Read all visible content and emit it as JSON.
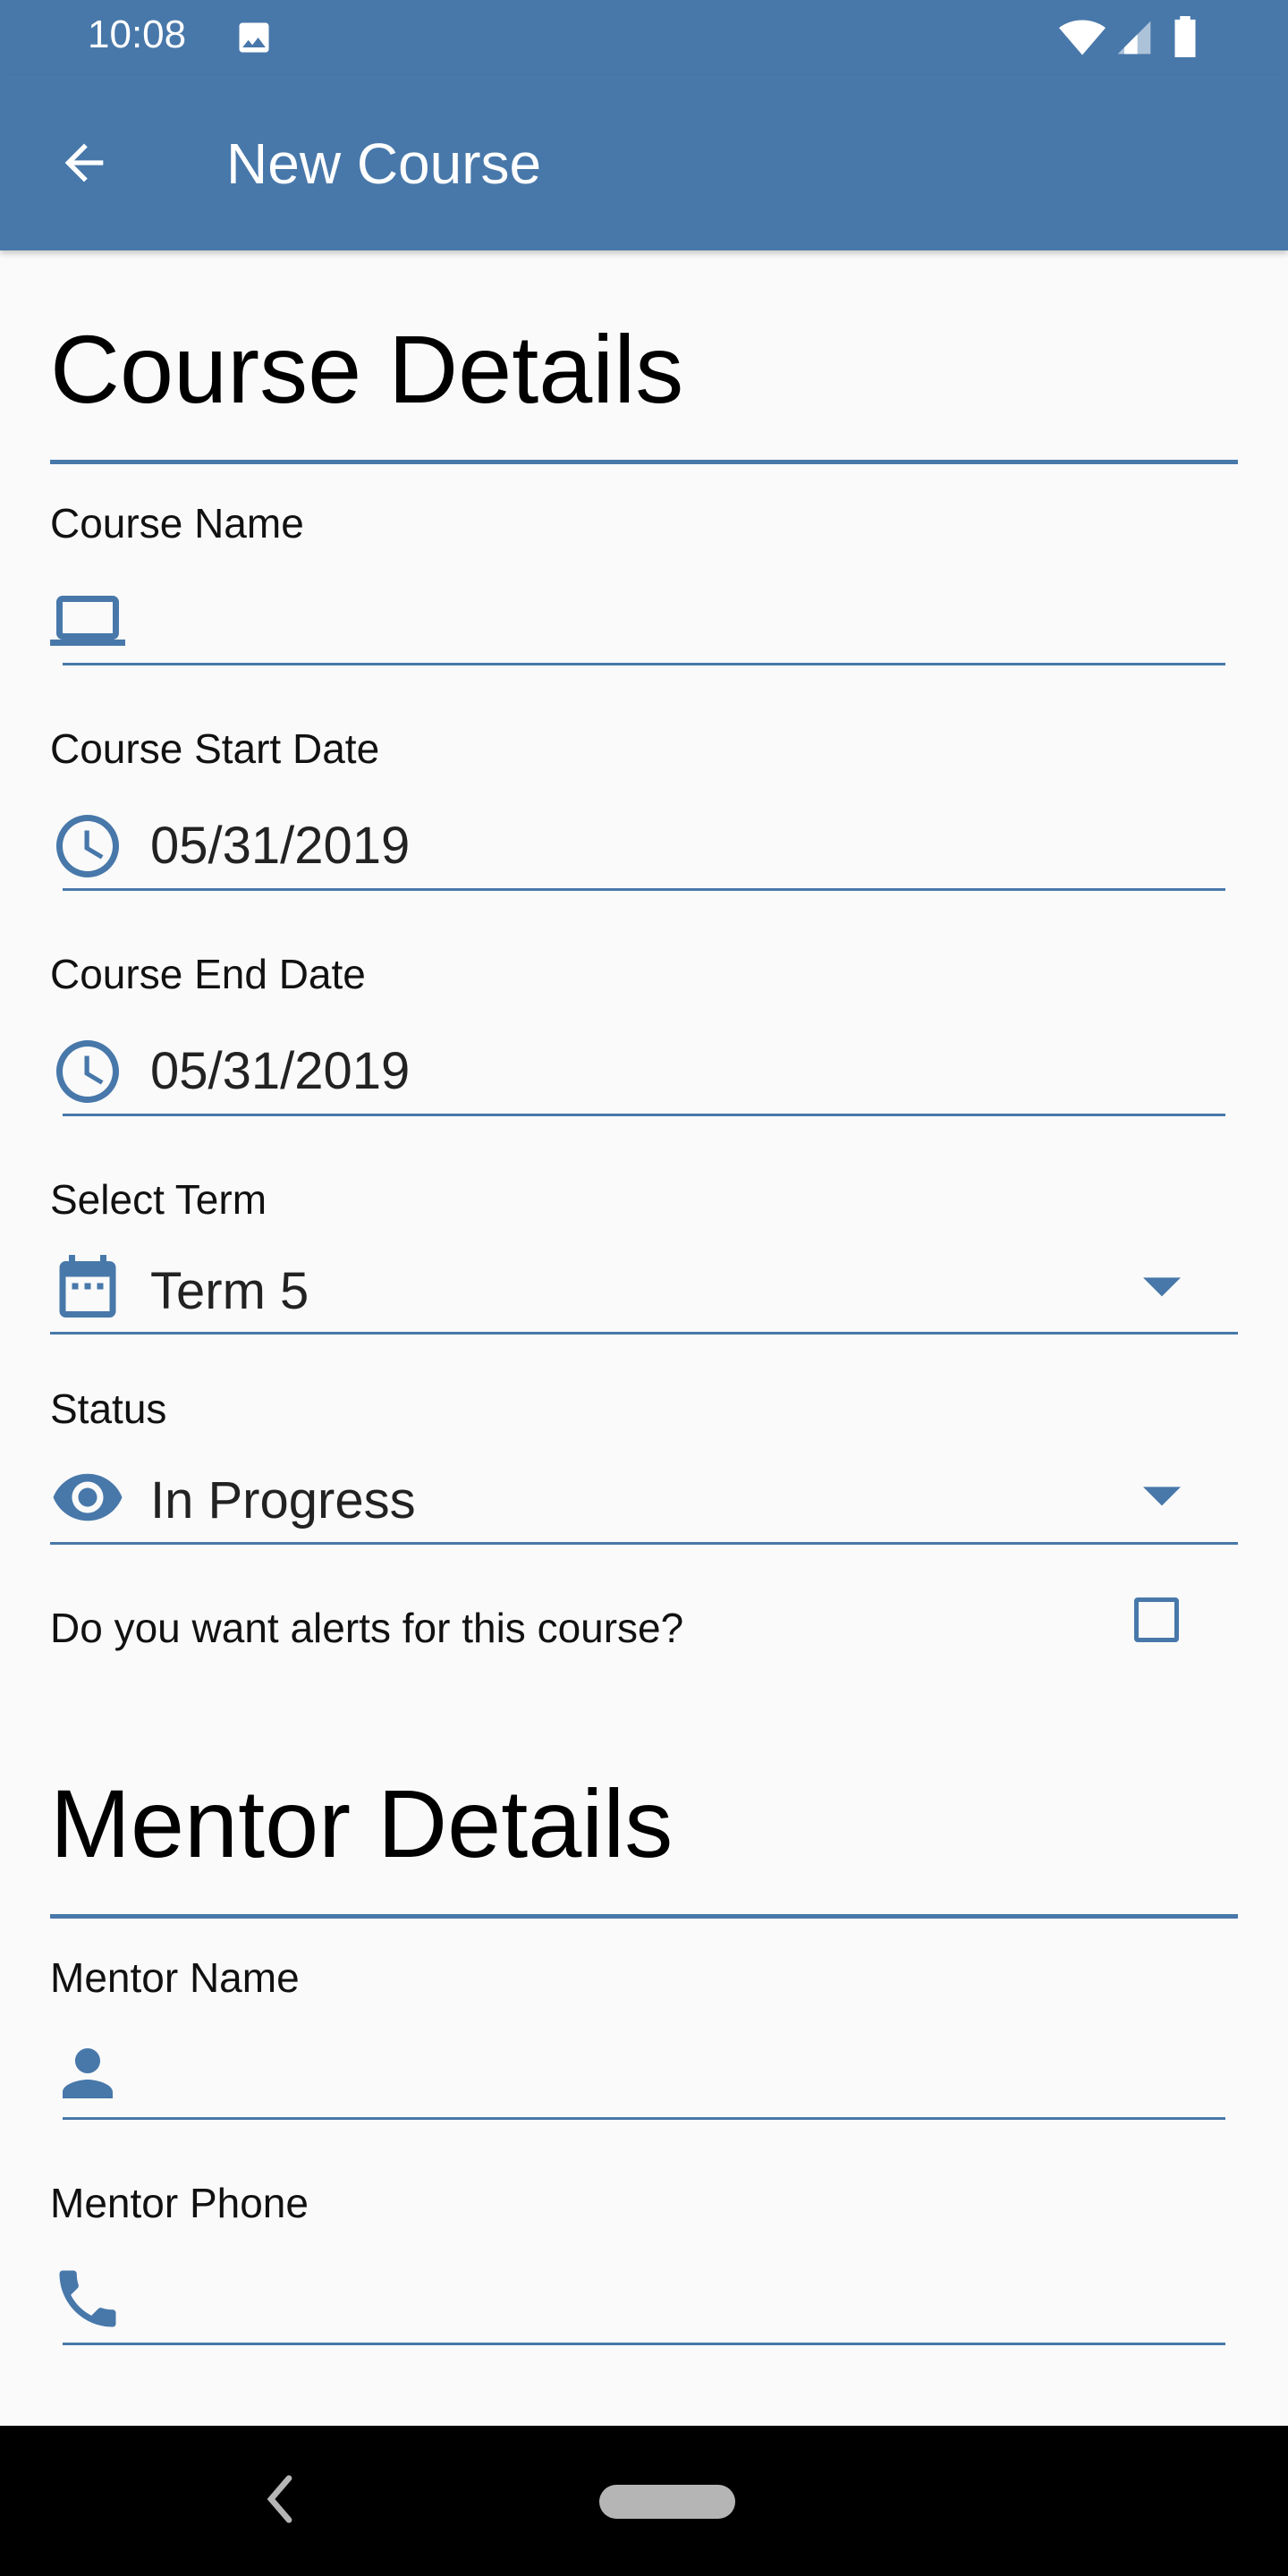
{
  "status_bar": {
    "time": "10:08"
  },
  "app_bar": {
    "title": "New Course"
  },
  "course_details": {
    "heading": "Course Details",
    "course_name": {
      "label": "Course Name",
      "value": ""
    },
    "start_date": {
      "label": "Course Start Date",
      "value": "05/31/2019"
    },
    "end_date": {
      "label": "Course End Date",
      "value": "05/31/2019"
    },
    "term": {
      "label": "Select Term",
      "value": "Term 5"
    },
    "status": {
      "label": "Status",
      "value": "In Progress"
    },
    "alerts": {
      "label": "Do you want alerts for this course?",
      "checked": false
    }
  },
  "mentor_details": {
    "heading": "Mentor Details",
    "mentor_name": {
      "label": "Mentor Name",
      "value": ""
    },
    "mentor_phone": {
      "label": "Mentor Phone",
      "value": ""
    }
  },
  "colors": {
    "primary": "#4878aa",
    "background": "#fafafa",
    "nav": "#000000"
  }
}
